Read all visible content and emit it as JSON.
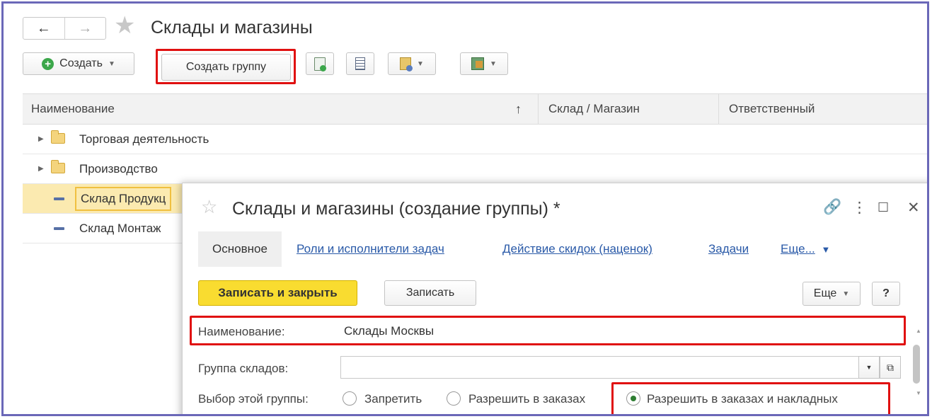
{
  "window": {
    "title": "Склады и магазины",
    "nav": {
      "back": "←",
      "forward": "→"
    }
  },
  "toolbar": {
    "create_label": "Создать",
    "create_group_label": "Создать группу"
  },
  "table": {
    "columns": [
      "Наименование",
      "Склад / Магазин",
      "Ответственный"
    ],
    "sort_indicator": "↑",
    "rows": [
      {
        "name": "Торговая деятельность",
        "type": "folder"
      },
      {
        "name": "Производство",
        "type": "folder"
      },
      {
        "name": "Склад Продукц",
        "type": "item",
        "selected": true
      },
      {
        "name": "Склад Монтаж",
        "type": "item"
      }
    ]
  },
  "dialog": {
    "title": "Склады и магазины (создание группы) *",
    "controls": {
      "link": "🔗",
      "menu": "⋮",
      "maximize": "☐",
      "close": "✕"
    },
    "tabs": {
      "active": "Основное",
      "roles": "Роли и исполнители задач",
      "discounts": "Действие скидок (наценок)",
      "tasks": "Задачи",
      "more": "Еще..."
    },
    "actions": {
      "save_close": "Записать и закрыть",
      "save": "Записать",
      "more": "Еще",
      "help": "?"
    },
    "form": {
      "name_label": "Наименование:",
      "name_value": "Склады Москвы",
      "group_label": "Группа складов:",
      "group_value": "",
      "choice_label": "Выбор этой группы:",
      "options": [
        "Запретить",
        "Разрешить в заказах",
        "Разрешить в заказах и накладных"
      ],
      "selected_option": "Разрешить в заказах и накладных"
    }
  },
  "colors": {
    "frame": "#6b68b8",
    "highlight": "#e01010",
    "accent_yellow": "#f9dc30",
    "link": "#2a5aa8",
    "selected_row": "#fbeab0"
  }
}
